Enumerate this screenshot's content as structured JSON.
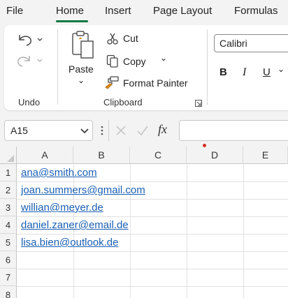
{
  "menu": {
    "tabs": [
      "File",
      "Home",
      "Insert",
      "Page Layout",
      "Formulas"
    ],
    "active_tab": "Home"
  },
  "ribbon": {
    "undo_group_label": "Undo",
    "clipboard_group_label": "Clipboard",
    "paste_label": "Paste",
    "cut_label": "Cut",
    "copy_label": "Copy",
    "format_painter_label": "Format Painter",
    "font_name": "Calibri",
    "bold_label": "B",
    "italic_label": "I",
    "underline_label": "U"
  },
  "formula_bar": {
    "name_box": "A15",
    "fx_label": "fx",
    "value": ""
  },
  "sheet": {
    "columns": [
      "A",
      "B",
      "C",
      "D",
      "E"
    ],
    "rows": [
      "1",
      "2",
      "3",
      "4",
      "5",
      "6",
      "7",
      "8"
    ],
    "cells": [
      "ana@smith.com",
      "joan.summers@gmail.com",
      "willian@meyer.de",
      "daniel.zaner@email.de",
      "lisa.bien@outlook.de"
    ]
  },
  "colors": {
    "accent": "#107c41",
    "link": "#1a5fb4",
    "marker": "#d93025"
  }
}
